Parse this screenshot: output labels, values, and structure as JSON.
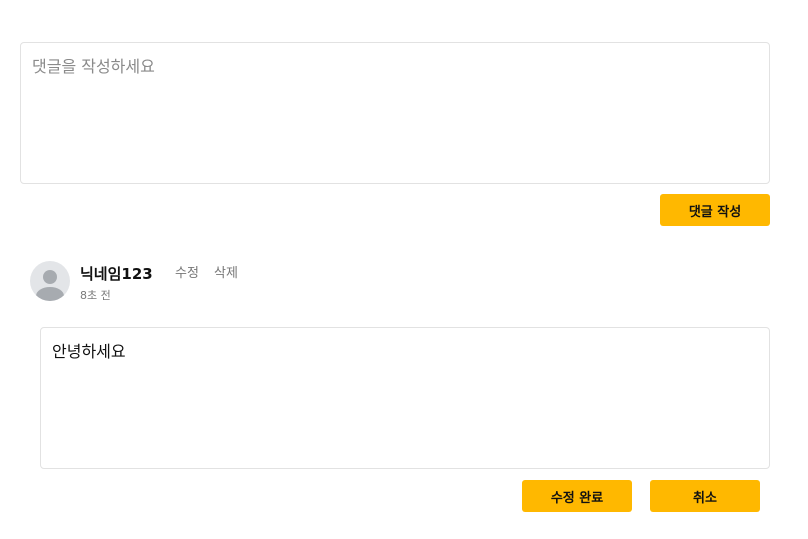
{
  "new_comment": {
    "placeholder": "댓글을 작성하세요",
    "submit_label": "댓글 작성"
  },
  "comment": {
    "nickname": "닉네임123",
    "edit_label": "수정",
    "delete_label": "삭제",
    "time_ago": "8초 전",
    "edit_text": "안녕하세요",
    "save_label": "수정 완료",
    "cancel_label": "취소"
  },
  "colors": {
    "accent": "#ffb800",
    "border": "#e2e2e2",
    "avatar_bg": "#e3e5e8",
    "avatar_fg": "#a7abb0"
  },
  "icons": {
    "avatar": "user-silhouette-icon"
  }
}
